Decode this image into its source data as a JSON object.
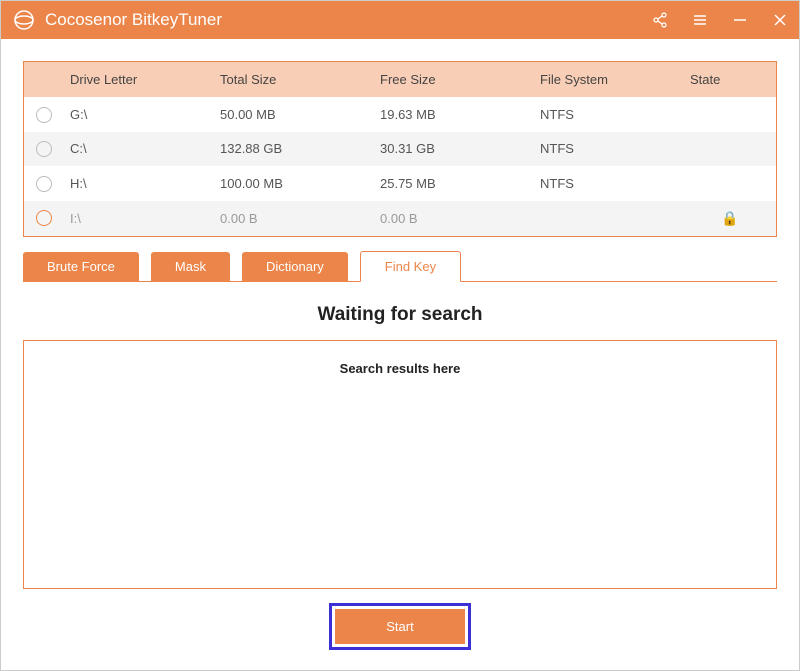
{
  "app": {
    "title": "Cocosenor BitkeyTuner"
  },
  "table": {
    "headers": {
      "drive": "Drive Letter",
      "total": "Total Size",
      "free": "Free Size",
      "fs": "File System",
      "state": "State"
    },
    "rows": [
      {
        "drive": "G:\\",
        "total": "50.00 MB",
        "free": "19.63 MB",
        "fs": "NTFS",
        "locked": false
      },
      {
        "drive": "C:\\",
        "total": "132.88 GB",
        "free": "30.31 GB",
        "fs": "NTFS",
        "locked": false
      },
      {
        "drive": "H:\\",
        "total": "100.00 MB",
        "free": "25.75 MB",
        "fs": "NTFS",
        "locked": false
      },
      {
        "drive": "I:\\",
        "total": "0.00 B",
        "free": "0.00 B",
        "fs": "",
        "locked": true
      }
    ]
  },
  "tabs": {
    "brute": "Brute Force",
    "mask": "Mask",
    "dict": "Dictionary",
    "findkey": "Find Key",
    "active": "findkey"
  },
  "status": {
    "heading": "Waiting for search",
    "placeholder": "Search results here"
  },
  "buttons": {
    "start": "Start"
  }
}
